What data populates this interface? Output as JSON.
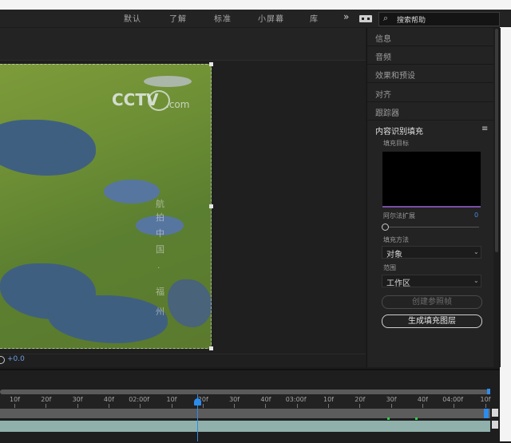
{
  "workspace": {
    "tabs": [
      {
        "label": "默认"
      },
      {
        "label": "了解"
      },
      {
        "label": "标准"
      },
      {
        "label": "小屏幕"
      },
      {
        "label": "库"
      }
    ],
    "overflow": "»",
    "search_placeholder": "搜索帮助",
    "icons": [
      "keyboard-icon",
      "search-icon",
      "chevron-more-icon"
    ]
  },
  "viewer": {
    "watermark_logo": "CCTV.com",
    "overlay_text": [
      "航",
      "拍",
      "中",
      "国",
      "·",
      "福",
      "州"
    ],
    "exposure_value": "+0.0"
  },
  "panels": {
    "items": [
      {
        "label": "信息"
      },
      {
        "label": "音频"
      },
      {
        "label": "效果和预设"
      },
      {
        "label": "对齐"
      },
      {
        "label": "跟踪器"
      }
    ],
    "content_aware_fill": {
      "title": "内容识别填充",
      "menu_icon": "≡",
      "fill_target_label": "填充目标",
      "alpha_expansion_label": "阿尔法扩展",
      "alpha_expansion_value": "0",
      "fill_method_label": "填充方法",
      "fill_method_value": "对象",
      "range_label": "范围",
      "range_value": "工作区",
      "create_reference_button": "创建参照帧",
      "generate_button": "生成填充图层"
    }
  },
  "timeline": {
    "ruler_labels": [
      "10f",
      "20f",
      "30f",
      "40f",
      "02:00f",
      "10f",
      "20f",
      "30f",
      "40f",
      "03:00f",
      "10f",
      "20f",
      "30f",
      "40f",
      "04:00f",
      "10f"
    ],
    "layer_color": "#8fb0ab",
    "playhead_color": "#2d8ceb"
  }
}
